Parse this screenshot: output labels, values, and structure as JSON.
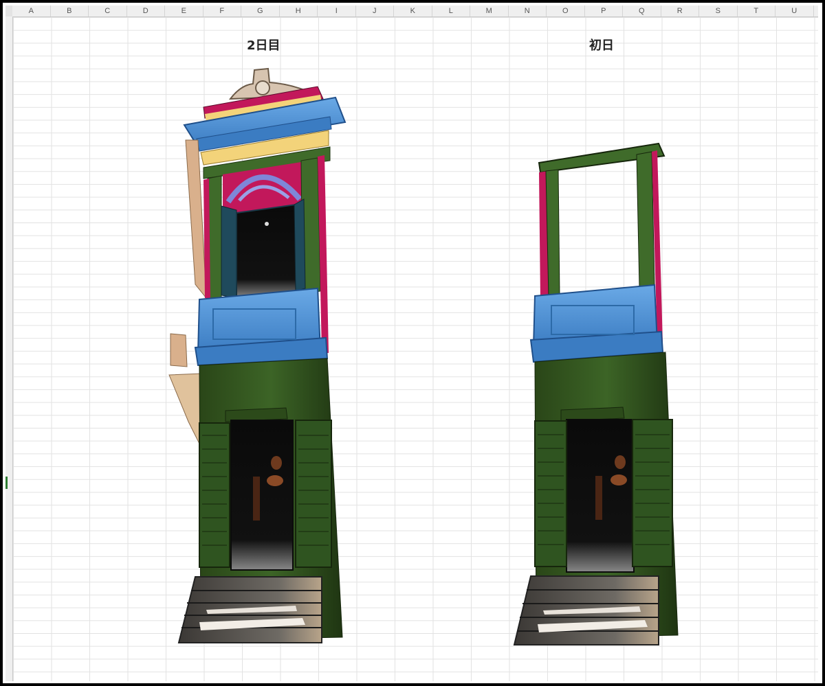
{
  "columns": [
    "A",
    "B",
    "C",
    "D",
    "E",
    "F",
    "G",
    "H",
    "I",
    "J",
    "K",
    "L",
    "M",
    "N",
    "O",
    "P",
    "Q",
    "R",
    "S",
    "T",
    "U"
  ],
  "titles": {
    "left": "2日目",
    "right": "初日"
  },
  "colors": {
    "green_dark": "#2d4a1e",
    "green": "#3f6b2a",
    "blue": "#4a8fd4",
    "magenta": "#c2185b",
    "yellow": "#f3d37a",
    "beige": "#d9b08c",
    "stone": "#7a7670"
  }
}
